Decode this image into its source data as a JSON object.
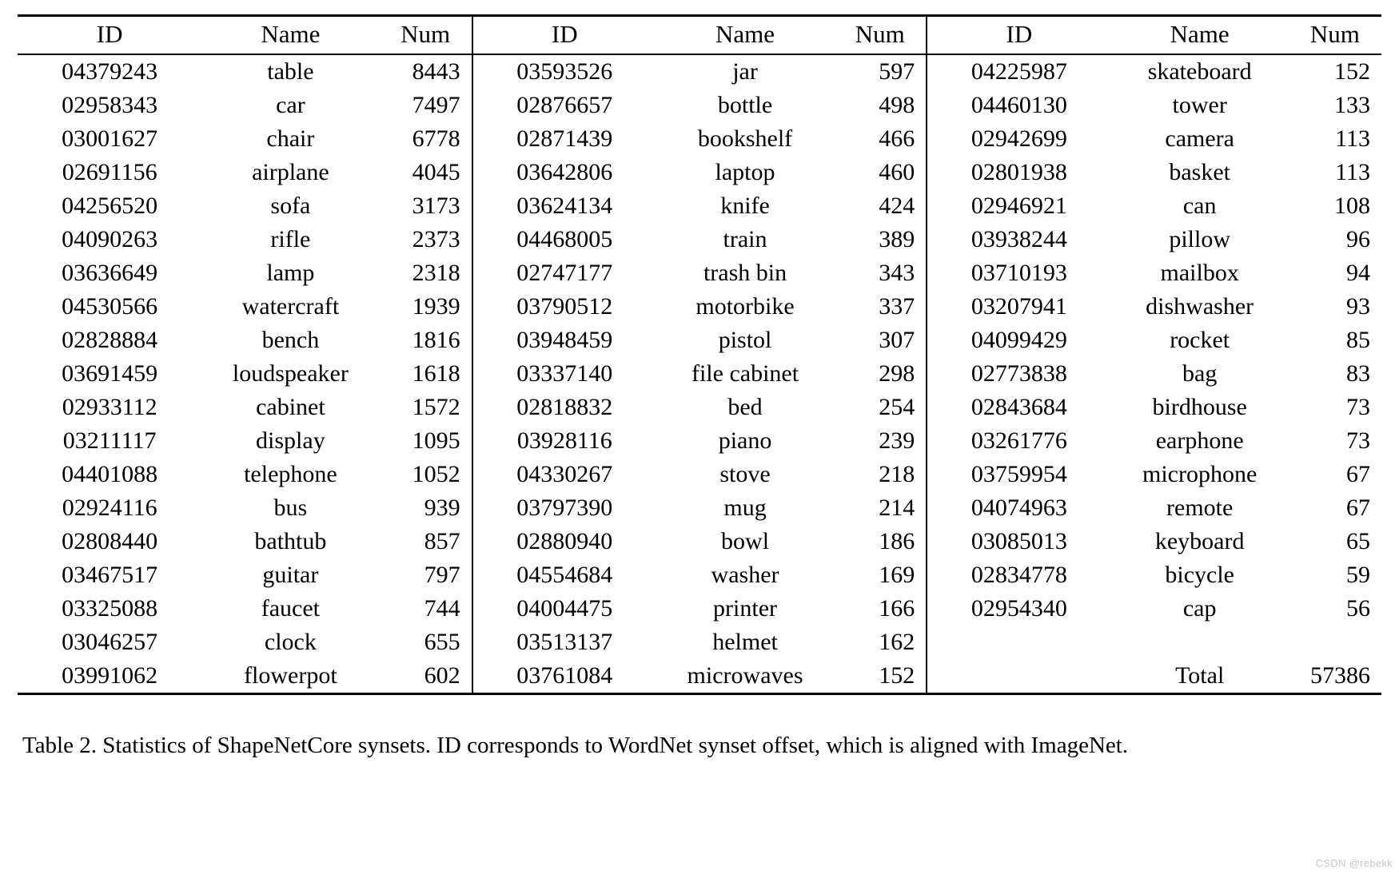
{
  "table": {
    "headers": {
      "id": "ID",
      "name": "Name",
      "num": "Num"
    },
    "total_label": "Total",
    "total_value": "57386",
    "groups": [
      {
        "rows": [
          {
            "id": "04379243",
            "name": "table",
            "num": "8443"
          },
          {
            "id": "02958343",
            "name": "car",
            "num": "7497"
          },
          {
            "id": "03001627",
            "name": "chair",
            "num": "6778"
          },
          {
            "id": "02691156",
            "name": "airplane",
            "num": "4045"
          },
          {
            "id": "04256520",
            "name": "sofa",
            "num": "3173"
          },
          {
            "id": "04090263",
            "name": "rifle",
            "num": "2373"
          },
          {
            "id": "03636649",
            "name": "lamp",
            "num": "2318"
          },
          {
            "id": "04530566",
            "name": "watercraft",
            "num": "1939"
          },
          {
            "id": "02828884",
            "name": "bench",
            "num": "1816"
          },
          {
            "id": "03691459",
            "name": "loudspeaker",
            "num": "1618"
          },
          {
            "id": "02933112",
            "name": "cabinet",
            "num": "1572"
          },
          {
            "id": "03211117",
            "name": "display",
            "num": "1095"
          },
          {
            "id": "04401088",
            "name": "telephone",
            "num": "1052"
          },
          {
            "id": "02924116",
            "name": "bus",
            "num": "939"
          },
          {
            "id": "02808440",
            "name": "bathtub",
            "num": "857"
          },
          {
            "id": "03467517",
            "name": "guitar",
            "num": "797"
          },
          {
            "id": "03325088",
            "name": "faucet",
            "num": "744"
          },
          {
            "id": "03046257",
            "name": "clock",
            "num": "655"
          },
          {
            "id": "03991062",
            "name": "flowerpot",
            "num": "602"
          }
        ]
      },
      {
        "rows": [
          {
            "id": "03593526",
            "name": "jar",
            "num": "597"
          },
          {
            "id": "02876657",
            "name": "bottle",
            "num": "498"
          },
          {
            "id": "02871439",
            "name": "bookshelf",
            "num": "466"
          },
          {
            "id": "03642806",
            "name": "laptop",
            "num": "460"
          },
          {
            "id": "03624134",
            "name": "knife",
            "num": "424"
          },
          {
            "id": "04468005",
            "name": "train",
            "num": "389"
          },
          {
            "id": "02747177",
            "name": "trash bin",
            "num": "343"
          },
          {
            "id": "03790512",
            "name": "motorbike",
            "num": "337"
          },
          {
            "id": "03948459",
            "name": "pistol",
            "num": "307"
          },
          {
            "id": "03337140",
            "name": "file cabinet",
            "num": "298"
          },
          {
            "id": "02818832",
            "name": "bed",
            "num": "254"
          },
          {
            "id": "03928116",
            "name": "piano",
            "num": "239"
          },
          {
            "id": "04330267",
            "name": "stove",
            "num": "218"
          },
          {
            "id": "03797390",
            "name": "mug",
            "num": "214"
          },
          {
            "id": "02880940",
            "name": "bowl",
            "num": "186"
          },
          {
            "id": "04554684",
            "name": "washer",
            "num": "169"
          },
          {
            "id": "04004475",
            "name": "printer",
            "num": "166"
          },
          {
            "id": "03513137",
            "name": "helmet",
            "num": "162"
          },
          {
            "id": "03761084",
            "name": "microwaves",
            "num": "152"
          }
        ]
      },
      {
        "rows": [
          {
            "id": "04225987",
            "name": "skateboard",
            "num": "152"
          },
          {
            "id": "04460130",
            "name": "tower",
            "num": "133"
          },
          {
            "id": "02942699",
            "name": "camera",
            "num": "113"
          },
          {
            "id": "02801938",
            "name": "basket",
            "num": "113"
          },
          {
            "id": "02946921",
            "name": "can",
            "num": "108"
          },
          {
            "id": "03938244",
            "name": "pillow",
            "num": "96"
          },
          {
            "id": "03710193",
            "name": "mailbox",
            "num": "94"
          },
          {
            "id": "03207941",
            "name": "dishwasher",
            "num": "93"
          },
          {
            "id": "04099429",
            "name": "rocket",
            "num": "85"
          },
          {
            "id": "02773838",
            "name": "bag",
            "num": "83"
          },
          {
            "id": "02843684",
            "name": "birdhouse",
            "num": "73"
          },
          {
            "id": "03261776",
            "name": "earphone",
            "num": "73"
          },
          {
            "id": "03759954",
            "name": "microphone",
            "num": "67"
          },
          {
            "id": "04074963",
            "name": "remote",
            "num": "67"
          },
          {
            "id": "03085013",
            "name": "keyboard",
            "num": "65"
          },
          {
            "id": "02834778",
            "name": "bicycle",
            "num": "59"
          },
          {
            "id": "02954340",
            "name": "cap",
            "num": "56"
          },
          {
            "id": "",
            "name": "",
            "num": ""
          },
          {
            "id": "",
            "name": "",
            "num": ""
          }
        ]
      }
    ]
  },
  "caption": "Table 2. Statistics of ShapeNetCore synsets. ID corresponds to WordNet synset offset, which is aligned with ImageNet.",
  "watermark": "CSDN @rebekk"
}
